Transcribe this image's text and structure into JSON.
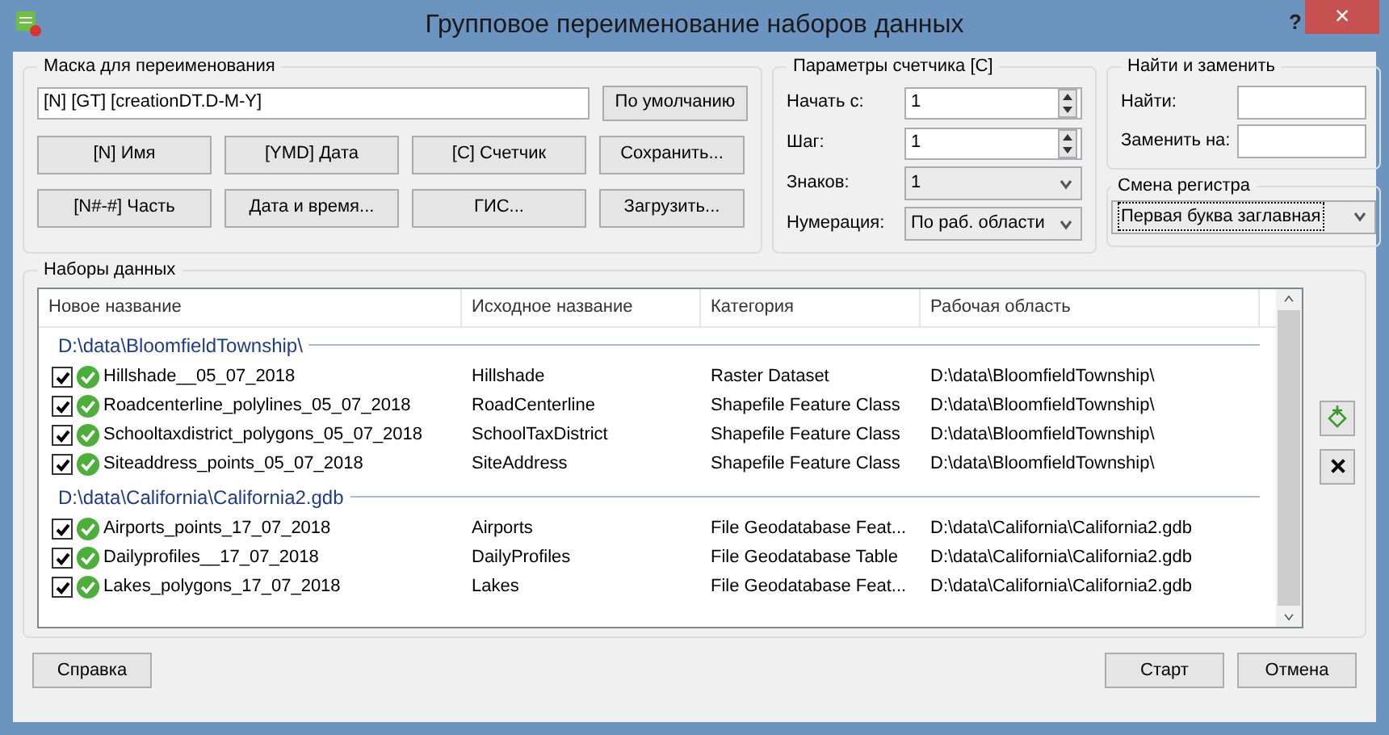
{
  "window": {
    "title": "Групповое переименование наборов данных",
    "help": "?",
    "close": "×"
  },
  "mask": {
    "legend": "Маска для переименования",
    "value": "[N] [GT] [creationDT.D-M-Y]",
    "default_button": "По умолчанию",
    "buttons": [
      [
        "[N] Имя",
        "[YMD] Дата",
        "[C] Счетчик",
        "Сохранить..."
      ],
      [
        "[N#-#] Часть",
        "Дата и время...",
        "ГИС...",
        "Загрузить..."
      ]
    ]
  },
  "counter": {
    "legend": "Параметры счетчика [C]",
    "fields": [
      {
        "kind": "spin",
        "label": "Начать с:",
        "value": "1"
      },
      {
        "kind": "spin",
        "label": "Шаг:",
        "value": "1"
      },
      {
        "kind": "select",
        "label": "Знаков:",
        "value": "1"
      },
      {
        "kind": "select",
        "label": "Нумерация:",
        "value": "По раб. области"
      }
    ]
  },
  "find_replace": {
    "legend": "Найти и заменить",
    "fields": [
      {
        "label": "Найти:"
      },
      {
        "label": "Заменить на:"
      }
    ]
  },
  "case_change": {
    "legend": "Смена регистра",
    "value": "Первая буква заглавная"
  },
  "datasets": {
    "legend": "Наборы данных",
    "columns": [
      "Новое название",
      "Исходное название",
      "Категория",
      "Рабочая область"
    ],
    "groups": [
      {
        "path": "D:\\data\\BloomfieldTownship\\",
        "rows": [
          {
            "checked": true,
            "cells": [
              "Hillshade__05_07_2018",
              "Hillshade",
              "Raster Dataset",
              "D:\\data\\BloomfieldTownship\\"
            ]
          },
          {
            "checked": true,
            "cells": [
              "Roadcenterline_polylines_05_07_2018",
              "RoadCenterline",
              "Shapefile Feature Class",
              "D:\\data\\BloomfieldTownship\\"
            ]
          },
          {
            "checked": true,
            "cells": [
              "Schooltaxdistrict_polygons_05_07_2018",
              "SchoolTaxDistrict",
              "Shapefile Feature Class",
              "D:\\data\\BloomfieldTownship\\"
            ]
          },
          {
            "checked": true,
            "cells": [
              "Siteaddress_points_05_07_2018",
              "SiteAddress",
              "Shapefile Feature Class",
              "D:\\data\\BloomfieldTownship\\"
            ]
          }
        ]
      },
      {
        "path": "D:\\data\\California\\California2.gdb",
        "rows": [
          {
            "checked": true,
            "cells": [
              "Airports_points_17_07_2018",
              "Airports",
              "File Geodatabase Feat...",
              "D:\\data\\California\\California2.gdb"
            ]
          },
          {
            "checked": true,
            "cells": [
              "Dailyprofiles__17_07_2018",
              "DailyProfiles",
              "File Geodatabase Table",
              "D:\\data\\California\\California2.gdb"
            ]
          },
          {
            "checked": true,
            "cells": [
              "Lakes_polygons_17_07_2018",
              "Lakes",
              "File Geodatabase Feat...",
              "D:\\data\\California\\California2.gdb"
            ]
          }
        ]
      }
    ]
  },
  "footer": {
    "help_button": "Справка",
    "start_button": "Старт",
    "cancel_button": "Отмена"
  }
}
